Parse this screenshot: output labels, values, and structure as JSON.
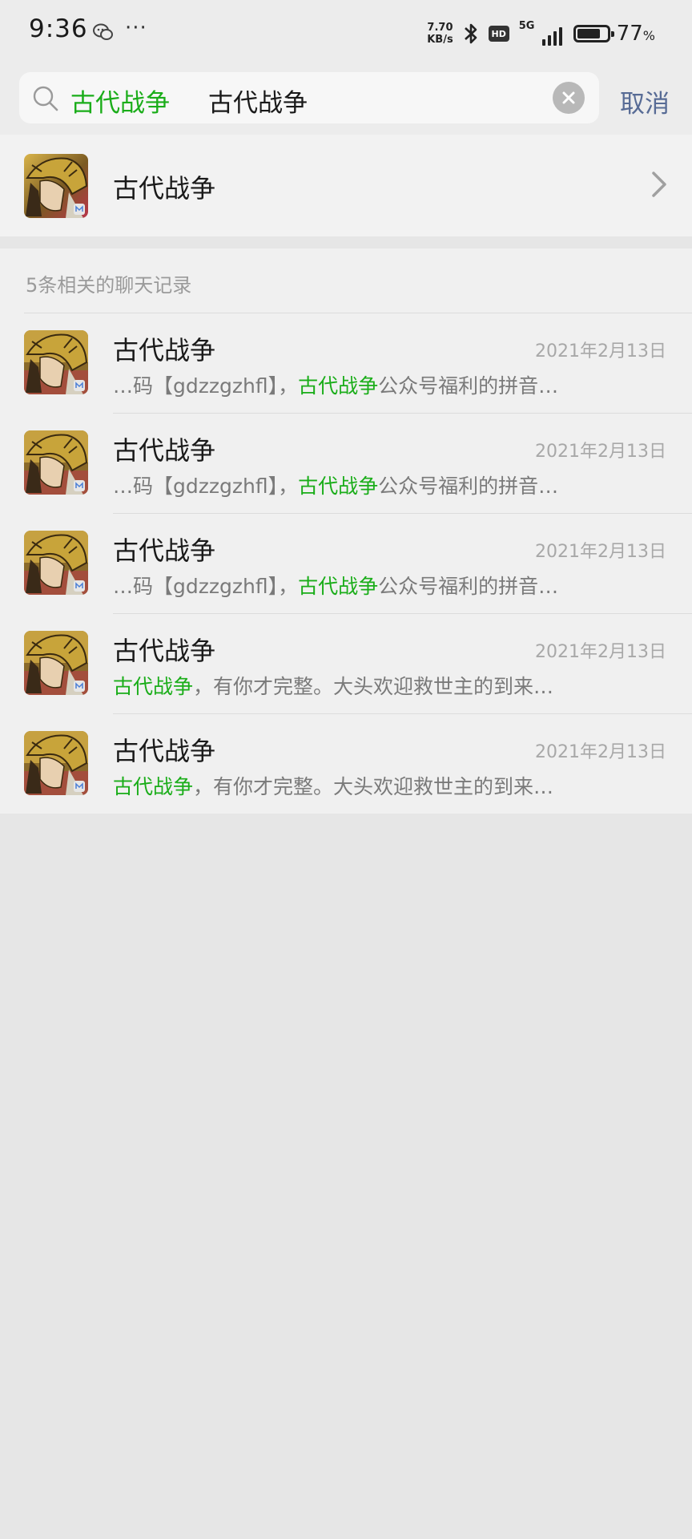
{
  "status_bar": {
    "time": "9:36",
    "dots": "···",
    "speed_value": "7.70",
    "speed_unit": "KB/s",
    "hd": "HD",
    "network": "5G",
    "battery_percent": "77",
    "battery_symbol": "%",
    "battery_level": 0.77
  },
  "search": {
    "token": "古代战争",
    "query": "古代战争",
    "cancel_label": "取消"
  },
  "account": {
    "name": "古代战争"
  },
  "chat_section": {
    "title": "5条相关的聊天记录"
  },
  "chats": [
    {
      "title": "古代战争",
      "date": "2021年2月13日",
      "pre": "…码【gdzzgzhfl】，",
      "hl": "古代战争",
      "post": "公众号福利的拼音…"
    },
    {
      "title": "古代战争",
      "date": "2021年2月13日",
      "pre": "…码【gdzzgzhfl】，",
      "hl": "古代战争",
      "post": "公众号福利的拼音…"
    },
    {
      "title": "古代战争",
      "date": "2021年2月13日",
      "pre": "…码【gdzzgzhfl】，",
      "hl": "古代战争",
      "post": "公众号福利的拼音…"
    },
    {
      "title": "古代战争",
      "date": "2021年2月13日",
      "pre": "",
      "hl": "古代战争",
      "post": "，有你才完整。大头欢迎救世主的到来…"
    },
    {
      "title": "古代战争",
      "date": "2021年2月13日",
      "pre": "",
      "hl": "古代战争",
      "post": "，有你才完整。大头欢迎救世主的到来…"
    }
  ],
  "icons": {
    "search": "search-icon",
    "clear": "clear-icon",
    "chevron": "chevron-right-icon",
    "avatar": "game-avatar-icon"
  },
  "colors": {
    "highlight": "#1aad19",
    "cancel": "#576b95"
  }
}
